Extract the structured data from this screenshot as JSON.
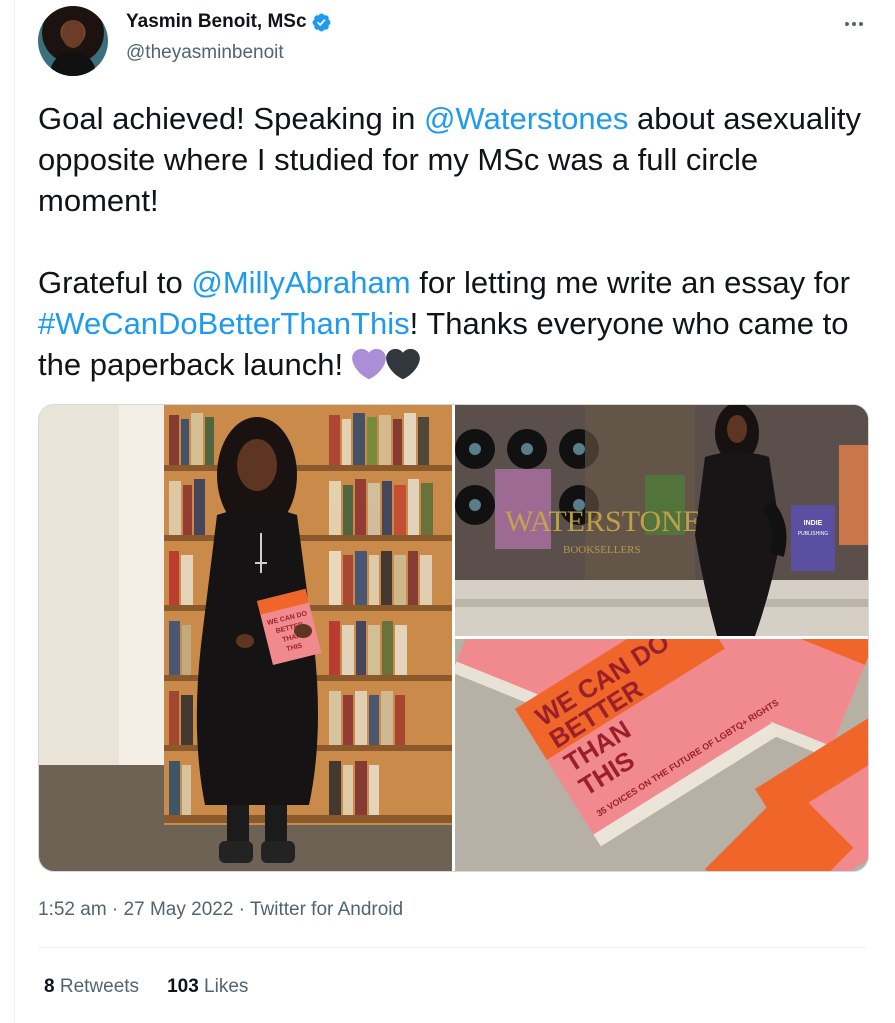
{
  "author": {
    "name": "Yasmin Benoit, MSc",
    "handle": "@theyasminbenoit",
    "verified": true
  },
  "tweet": {
    "p1_a": "Goal achieved! Speaking in ",
    "p1_link": "@Waterstones",
    "p1_b": " about asexuality opposite where I studied for my MSc was a full circle moment!",
    "p2_a": "Grateful to ",
    "p2_link1": "@MillyAbraham",
    "p2_b": " for letting me write an essay for ",
    "p2_link2": "#WeCanDoBetterThanThis",
    "p2_c": "! Thanks everyone who came to the paperback launch! ",
    "emoji": [
      "purple-heart",
      "black-heart"
    ]
  },
  "photos": {
    "book_cover": "WE CAN DO BETTER THAN THIS",
    "store_sign": "WATERSTONES",
    "store_sub": "BOOKSELLERS",
    "poster": "INDIE PUBLISHING",
    "stack_lines": [
      "WE CAN DO",
      "BETTER",
      "THAN",
      "THIS"
    ],
    "stack_sub": "35 VOICES ON THE FUTURE OF LGBTQ+ RIGHTS"
  },
  "meta": {
    "time": "1:52 am",
    "sep1": " · ",
    "date": "27 May 2022",
    "sep2": " · ",
    "source": "Twitter for Android"
  },
  "stats": {
    "retweets_count": "8",
    "retweets_label": " Retweets",
    "likes_count": "103",
    "likes_label": " Likes"
  },
  "colors": {
    "link": "#1d9bf0",
    "secondary_text": "#536471",
    "purple_heart": "#aa8ed6",
    "black_heart": "#31373d",
    "book_orange": "#f0662a",
    "book_pink": "#f08a8f"
  }
}
